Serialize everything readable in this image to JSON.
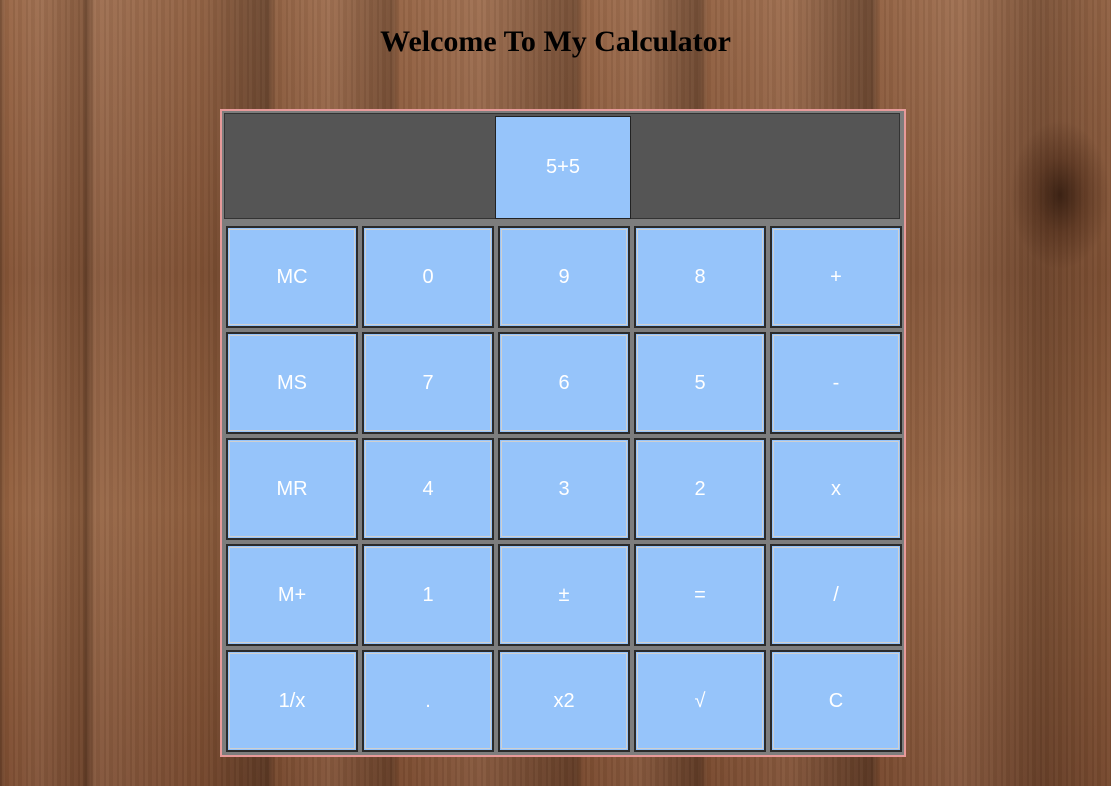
{
  "page": {
    "title": "Welcome To My Calculator"
  },
  "colors": {
    "key_bg": "#96c4fa",
    "display_panel": "#555555",
    "frame_border": "#e79a9a",
    "key_text": "#ffffff"
  },
  "calculator": {
    "display_value": "5+5",
    "keys": [
      [
        "MC",
        "0",
        "9",
        "8",
        "+"
      ],
      [
        "MS",
        "7",
        "6",
        "5",
        "-"
      ],
      [
        "MR",
        "4",
        "3",
        "2",
        "x"
      ],
      [
        "M+",
        "1",
        "±",
        "=",
        "/"
      ],
      [
        "1/x",
        ".",
        "x2",
        "√",
        "C"
      ]
    ]
  }
}
